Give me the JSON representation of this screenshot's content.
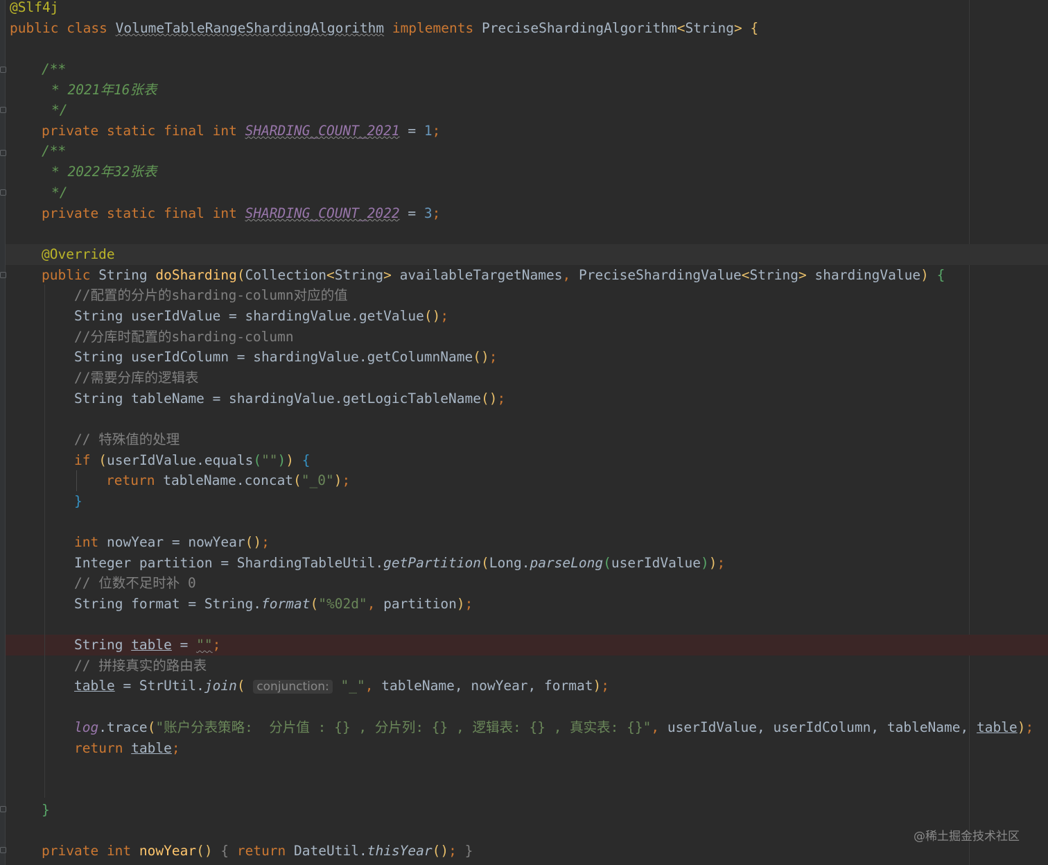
{
  "code": {
    "class_annotation": "@Slf4j",
    "class_decl": {
      "kw_public": "public",
      "kw_class": "class",
      "name": "VolumeTableRangeShardingAlgorithm",
      "kw_implements": "implements",
      "iface": "PreciseShardingAlgorithm",
      "generic_open": "<",
      "generic_type": "String",
      "generic_close": ">",
      "brace": "{"
    },
    "doc_open": "/**",
    "doc_close": "*/",
    "doc_2021": "* 2021年16张表",
    "doc_2022": "* 2022年32张表",
    "kw_private": "private",
    "kw_static": "static",
    "kw_final": "final",
    "kw_int": "int",
    "const_2021": "SHARDING_COUNT_2021",
    "const_2022": "SHARDING_COUNT_2022",
    "eq": "=",
    "val_2021": "1",
    "val_2022": "3",
    "semi": ";",
    "override": "@Override",
    "method_decl": {
      "kw_public": "public",
      "ret": "String",
      "name": "doSharding",
      "paren_open": "(",
      "p1_type": "Collection",
      "p1_generic": "String",
      "p1_name": "availableTargetNames",
      "comma": ",",
      "p2_type": "PreciseShardingValue",
      "p2_generic": "String",
      "p2_name": "shardingValue",
      "paren_close": ")",
      "brace": "{"
    },
    "c1": "//配置的分片的sharding-column对应的值",
    "l_userIdValue": "String userIdValue = shardingValue.getValue",
    "c2": "//分库时配置的sharding-column",
    "l_userIdColumn": "String userIdColumn = shardingValue.getColumnName",
    "c3": "//需要分库的逻辑表",
    "l_tableName": "String tableName = shardingValue.getLogicTableName",
    "empty_parens": "()",
    "c4": "// 特殊值的处理",
    "kw_if": "if",
    "if_cond": "userIdValue.equals",
    "empty_str": "\"\"",
    "kw_return": "return",
    "concat_call": "tableName.concat",
    "concat_arg": "\"_0\"",
    "open_paren": "(",
    "close_paren": ")",
    "open_brace": "{",
    "close_brace": "}",
    "l_nowYear": "nowYear = nowYear",
    "l_partition_a": "Integer partition = ShardingTableUtil.",
    "getPartition": "getPartition",
    "l_partition_b": "Long.",
    "parseLong": "parseLong",
    "l_partition_c": "userIdValue",
    "c5": "// 位数不足时补 0",
    "l_format_a": "String format = String.",
    "format_fn": "format",
    "format_arg": "\"%02d\"",
    "l_format_b": " partition",
    "l_table_a": "String ",
    "table_var": "table",
    "c6": "// 拼接真实的路由表",
    "l_join_a": " = StrUtil.",
    "join_fn": "join",
    "join_hint": "conjunction:",
    "join_sep": "\"_\"",
    "join_args": " tableName, nowYear, format",
    "log_var": "log",
    "log_call": ".trace",
    "log_msg": "\"账户分表策略:  分片值 : {} , 分片列: {} , 逻辑表: {} , 真实表: {}\"",
    "log_args": " userIdValue, userIdColumn, tableName, ",
    "nowYear_fn": "nowYear",
    "dateutil": "DateUtil.",
    "thisYear": "thisYear"
  },
  "watermark": "@稀土掘金技术社区"
}
